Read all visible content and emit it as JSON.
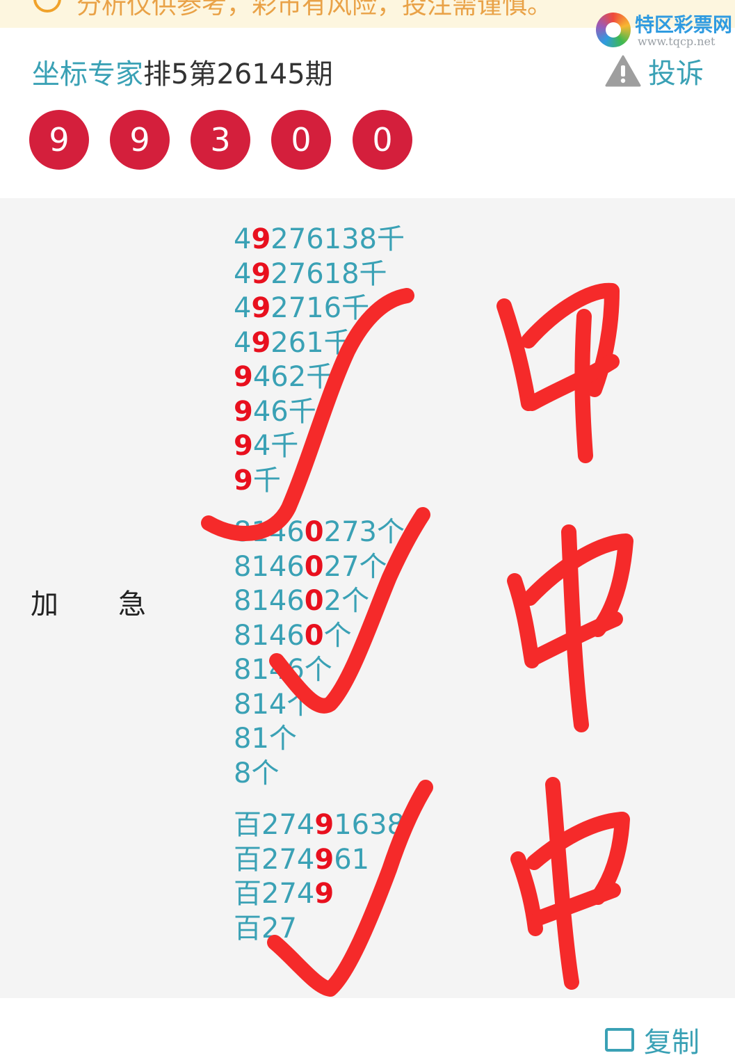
{
  "notice": {
    "text": "分析仅供参考，彩市有风险，投注需谨慎。",
    "icon": "warning-circle-icon"
  },
  "logo": {
    "name": "特区彩票网",
    "url": "www.tqcp.net"
  },
  "header": {
    "expert": "坐标专家",
    "issue": "排5第26145期",
    "report_label": "投诉",
    "report_icon": "warning-triangle-icon"
  },
  "result_numbers": [
    "9",
    "9",
    "3",
    "0",
    "0"
  ],
  "prediction": {
    "label_left": "加",
    "label_right": "急",
    "groups": [
      {
        "lines": [
          {
            "pre": "4",
            "hl": "9",
            "post": "276138千"
          },
          {
            "pre": "4",
            "hl": "9",
            "post": "27618千"
          },
          {
            "pre": "4",
            "hl": "9",
            "post": "2716千"
          },
          {
            "pre": "4",
            "hl": "9",
            "post": "261千"
          },
          {
            "pre": "",
            "hl": "9",
            "post": "462千"
          },
          {
            "pre": "",
            "hl": "9",
            "post": "46千"
          },
          {
            "pre": "",
            "hl": "9",
            "post": "4千"
          },
          {
            "pre": "",
            "hl": "9",
            "post": "千"
          }
        ]
      },
      {
        "lines": [
          {
            "pre": "8146",
            "hl": "0",
            "post": "273个"
          },
          {
            "pre": "8146",
            "hl": "0",
            "post": "27个"
          },
          {
            "pre": "8146",
            "hl": "0",
            "post": "2个"
          },
          {
            "pre": "8146",
            "hl": "0",
            "post": "个"
          },
          {
            "pre": "8146个",
            "hl": "",
            "post": ""
          },
          {
            "pre": "814个",
            "hl": "",
            "post": ""
          },
          {
            "pre": "81个",
            "hl": "",
            "post": ""
          },
          {
            "pre": "8个",
            "hl": "",
            "post": ""
          }
        ]
      },
      {
        "lines": [
          {
            "pre": "百274",
            "hl": "9",
            "post": "1638"
          },
          {
            "pre": "百274",
            "hl": "9",
            "post": "61"
          },
          {
            "pre": "百274",
            "hl": "9",
            "post": ""
          },
          {
            "pre": "百27",
            "hl": "",
            "post": ""
          }
        ]
      }
    ]
  },
  "handwriting": {
    "words": [
      "中",
      "中",
      "中"
    ],
    "color": "#f52a2a"
  },
  "copy": {
    "label": "复制",
    "icon": "copy-icon"
  },
  "colors": {
    "accent": "#3aa1b5",
    "ball": "#d41f3c",
    "highlight": "#e8101e",
    "notice_bg": "#fdf6df"
  }
}
